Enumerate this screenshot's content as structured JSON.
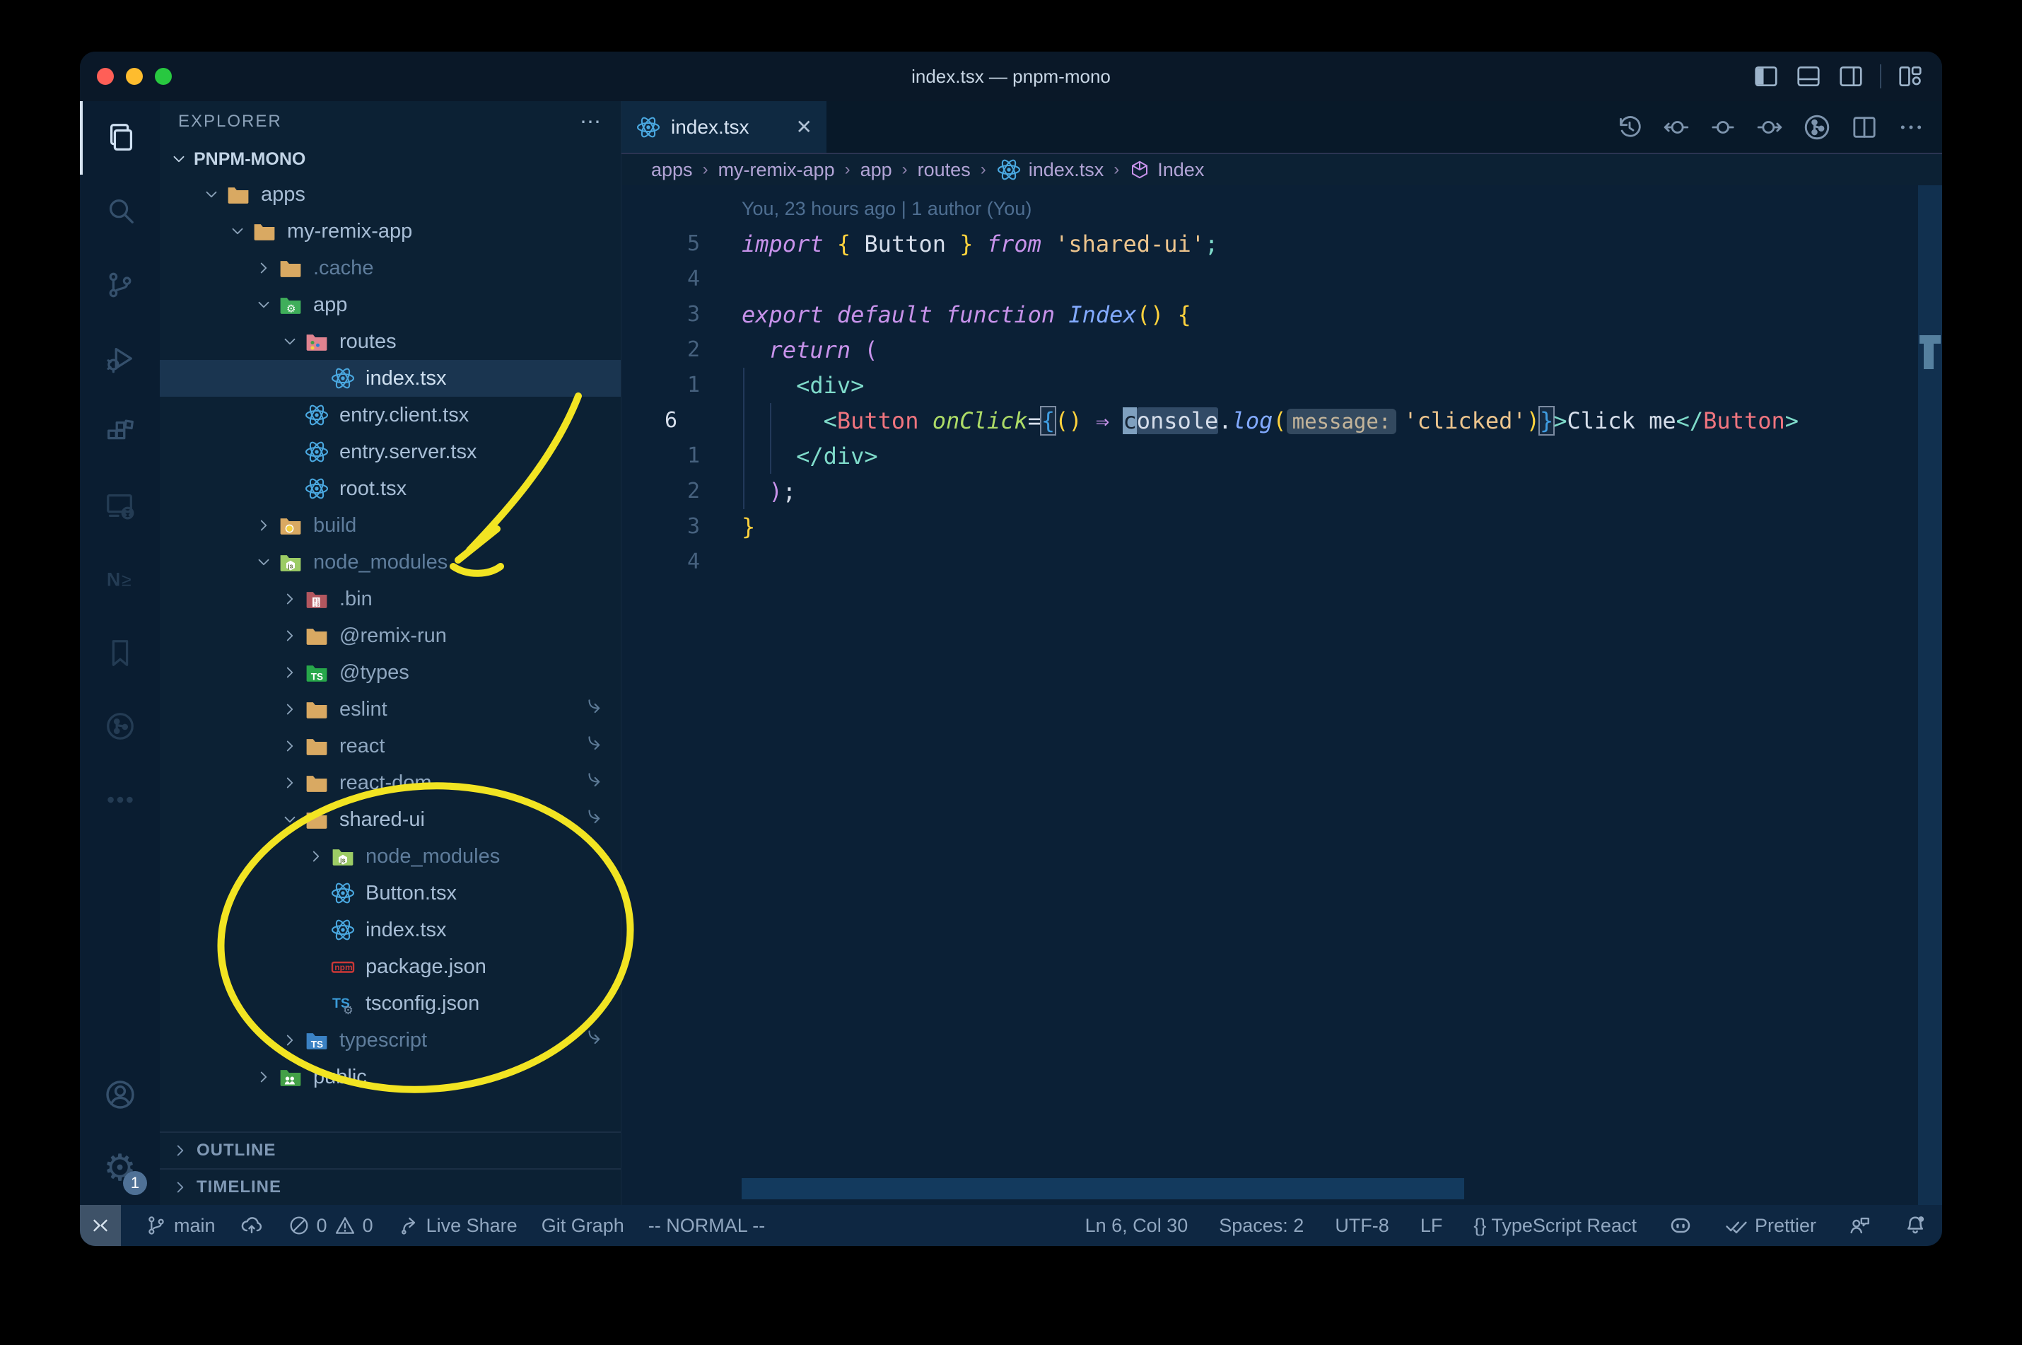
{
  "window": {
    "title": "index.tsx — pnpm-mono"
  },
  "titlebar": {
    "traffic_lights": [
      {
        "name": "close-button",
        "color": "#ff5f57"
      },
      {
        "name": "minimize-button",
        "color": "#febc2e"
      },
      {
        "name": "zoom-button",
        "color": "#28c840"
      }
    ],
    "layout_icons": [
      "toggle-sidebar-left-icon",
      "toggle-panel-icon",
      "toggle-sidebar-right-icon",
      "sep",
      "customize-layout-icon"
    ]
  },
  "activity_bar": {
    "top": [
      {
        "icon": "files-icon",
        "active": true
      },
      {
        "icon": "search-icon"
      },
      {
        "icon": "source-control-icon"
      },
      {
        "icon": "run-debug-icon"
      },
      {
        "icon": "extensions-icon"
      }
    ],
    "mid": [
      {
        "icon": "remote-explorer-icon",
        "dim": true
      },
      {
        "icon": "nx-console-icon",
        "dim": true
      },
      {
        "icon": "bookmarks-icon",
        "dim": true
      },
      {
        "icon": "git-graph-icon",
        "dim": true
      },
      {
        "icon": "more-views-icon",
        "dim": true
      }
    ],
    "bottom": [
      {
        "icon": "account-icon"
      },
      {
        "icon": "settings-gear-icon",
        "badge": "1"
      }
    ]
  },
  "sidebar": {
    "header": "EXPLORER",
    "header_more": "⋯",
    "section": "PNPM-MONO",
    "items": [
      {
        "label": "apps",
        "depth": 1,
        "icon": "folder-tan",
        "chevron": "down"
      },
      {
        "label": "my-remix-app",
        "depth": 2,
        "icon": "folder-tan",
        "chevron": "down"
      },
      {
        "label": ".cache",
        "depth": 3,
        "icon": "folder-tan",
        "chevron": "right",
        "dim": true
      },
      {
        "label": "app",
        "depth": 3,
        "icon": "folder-app",
        "chevron": "down"
      },
      {
        "label": "routes",
        "depth": 4,
        "icon": "folder-routes",
        "chevron": "down"
      },
      {
        "label": "index.tsx",
        "depth": 5,
        "icon": "react-icon",
        "selected": true
      },
      {
        "label": "entry.client.tsx",
        "depth": 4,
        "icon": "react-icon"
      },
      {
        "label": "entry.server.tsx",
        "depth": 4,
        "icon": "react-icon"
      },
      {
        "label": "root.tsx",
        "depth": 4,
        "icon": "react-icon"
      },
      {
        "label": "build",
        "depth": 3,
        "icon": "folder-dist",
        "chevron": "right",
        "dim": true
      },
      {
        "label": "node_modules",
        "depth": 3,
        "icon": "folder-nm",
        "chevron": "down",
        "dim": true
      },
      {
        "label": ".bin",
        "depth": 4,
        "icon": "folder-bin",
        "chevron": "right",
        "dim2": true
      },
      {
        "label": "@remix-run",
        "depth": 4,
        "icon": "folder-tan",
        "chevron": "right",
        "dim2": true
      },
      {
        "label": "@types",
        "depth": 4,
        "icon": "folder-types",
        "chevron": "right",
        "dim2": true
      },
      {
        "label": "eslint",
        "depth": 4,
        "icon": "folder-tan",
        "chevron": "right",
        "dim2": true,
        "symlink": true
      },
      {
        "label": "react",
        "depth": 4,
        "icon": "folder-tan",
        "chevron": "right",
        "dim2": true,
        "symlink": true
      },
      {
        "label": "react-dom",
        "depth": 4,
        "icon": "folder-tan",
        "chevron": "right",
        "dim2": true,
        "symlink": true
      },
      {
        "label": "shared-ui",
        "depth": 4,
        "icon": "folder-tan",
        "chevron": "down",
        "symlink": true
      },
      {
        "label": "node_modules",
        "depth": 5,
        "icon": "folder-nm",
        "chevron": "right",
        "dim": true
      },
      {
        "label": "Button.tsx",
        "depth": 5,
        "icon": "react-icon"
      },
      {
        "label": "index.tsx",
        "depth": 5,
        "icon": "react-icon"
      },
      {
        "label": "package.json",
        "depth": 5,
        "icon": "npm-icon"
      },
      {
        "label": "tsconfig.json",
        "depth": 5,
        "icon": "tsconfig-icon"
      },
      {
        "label": "typescript",
        "depth": 4,
        "icon": "folder-ts",
        "chevron": "right",
        "dim": true,
        "symlink": true
      },
      {
        "label": "public",
        "depth": 3,
        "icon": "folder-public",
        "chevron": "right"
      }
    ],
    "outline_label": "OUTLINE",
    "timeline_label": "TIMELINE"
  },
  "tab": {
    "label": "index.tsx",
    "icon": "react-icon",
    "close": "✕"
  },
  "editor_actions": [
    "history-icon",
    "previous-change-icon",
    "change-icon",
    "next-change-icon",
    "gitlens-icon",
    "split-editor-icon",
    "more-actions-icon"
  ],
  "breadcrumbs": [
    {
      "label": "apps"
    },
    {
      "label": "my-remix-app"
    },
    {
      "label": "app"
    },
    {
      "label": "routes"
    },
    {
      "label": "index.tsx",
      "icon": "react-icon"
    },
    {
      "label": "Index",
      "icon": "symbol-module-icon"
    }
  ],
  "editor": {
    "blame": "You, 23 hours ago | 1 author (You)",
    "lines": [
      {
        "type": "blame"
      },
      {
        "num": "5",
        "tokens": [
          [
            "import",
            "kw"
          ],
          [
            " ",
            "var"
          ],
          [
            "{",
            "y"
          ],
          [
            " Button ",
            "var"
          ],
          [
            "}",
            "y"
          ],
          [
            " ",
            "var"
          ],
          [
            "from",
            "kw"
          ],
          [
            " ",
            "var"
          ],
          [
            "'shared-ui'",
            "str"
          ],
          [
            ";",
            "semi"
          ]
        ]
      },
      {
        "num": "4",
        "tokens": []
      },
      {
        "num": "3",
        "tokens": [
          [
            "export",
            "kw"
          ],
          [
            " ",
            "var"
          ],
          [
            "default",
            "kw"
          ],
          [
            " ",
            "var"
          ],
          [
            "function",
            "kw"
          ],
          [
            " ",
            "var"
          ],
          [
            "Index",
            "fn"
          ],
          [
            "()",
            "y"
          ],
          [
            " ",
            "var"
          ],
          [
            "{",
            "y"
          ]
        ]
      },
      {
        "num": "2",
        "tokens": [
          [
            "  ",
            "var"
          ],
          [
            "return",
            "kw"
          ],
          [
            " ",
            "var"
          ],
          [
            "(",
            "m"
          ]
        ]
      },
      {
        "num": "1",
        "tokens": [
          [
            "    ",
            "var"
          ],
          [
            "<div>",
            "tag"
          ]
        ]
      },
      {
        "num": "6",
        "current": true,
        "tokens": [
          [
            "      ",
            "var"
          ],
          [
            "<",
            "tag"
          ],
          [
            "Button",
            "comp"
          ],
          [
            " ",
            "var"
          ],
          [
            "onClick",
            "attr"
          ],
          [
            "=",
            "var"
          ],
          [
            "{",
            "brk"
          ],
          [
            "()",
            "y"
          ],
          [
            " ",
            "var"
          ],
          [
            "⇒",
            "m"
          ],
          [
            " ",
            "var"
          ],
          [
            "c",
            "cursor"
          ],
          [
            "onsole",
            "hl"
          ],
          [
            ".",
            "var"
          ],
          [
            "log",
            "fn"
          ],
          [
            "(",
            "y"
          ],
          [
            "message:",
            "inlay"
          ],
          [
            "'clicked'",
            "str"
          ],
          [
            ")",
            "y"
          ],
          [
            "}",
            "brk"
          ],
          [
            ">",
            "tag"
          ],
          [
            "Click me",
            "var"
          ],
          [
            "</",
            "tag"
          ],
          [
            "Button",
            "comp"
          ],
          [
            ">",
            "tag"
          ]
        ]
      },
      {
        "num": "1",
        "tokens": [
          [
            "    ",
            "var"
          ],
          [
            "</div>",
            "tag"
          ]
        ]
      },
      {
        "num": "2",
        "tokens": [
          [
            "  ",
            "var"
          ],
          [
            ")",
            "m"
          ],
          [
            ";",
            "var"
          ]
        ]
      },
      {
        "num": "3",
        "tokens": [
          [
            "}",
            "y"
          ]
        ]
      },
      {
        "num": "4",
        "tokens": []
      }
    ]
  },
  "status_bar": {
    "left": [
      {
        "icon": "remote-icon",
        "remote": true
      },
      {
        "icon": "git-branch-icon",
        "label": "main"
      },
      {
        "icon": "cloud-upload-icon",
        "label": ""
      },
      {
        "icon": "error-icon",
        "label": "0",
        "icon2": "warning-icon",
        "label2": "0"
      },
      {
        "icon": "live-share-icon",
        "label": "Live Share"
      },
      {
        "label": "Git Graph"
      },
      {
        "label": "-- NORMAL --"
      }
    ],
    "right": [
      {
        "label": "Ln 6, Col 30"
      },
      {
        "label": "Spaces: 2"
      },
      {
        "label": "UTF-8"
      },
      {
        "label": "LF"
      },
      {
        "label": "{} TypeScript React"
      },
      {
        "icon": "copilot-icon"
      },
      {
        "icon": "double-check-icon",
        "label": "Prettier"
      },
      {
        "icon": "feedback-icon"
      },
      {
        "icon": "bell-icon"
      }
    ]
  },
  "annotations": {
    "color": "#f2e422",
    "shapes": [
      "hand-drawn-arrow-to-node_modules",
      "hand-drawn-ellipse-around-shared-ui"
    ]
  }
}
